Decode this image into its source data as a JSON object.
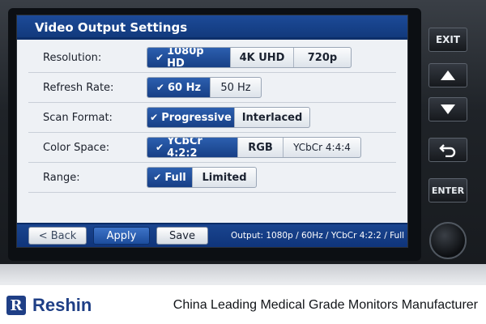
{
  "window": {
    "title": "Video Output Settings"
  },
  "settings": [
    {
      "label": "Resolution:",
      "options": [
        "1080p HD",
        "4K UHD",
        "720p"
      ],
      "selected": 0
    },
    {
      "label": "Refresh Rate:",
      "options": [
        "60 Hz",
        "50 Hz"
      ],
      "selected": 0
    },
    {
      "label": "Scan Format:",
      "options": [
        "Progressive",
        "Interlaced"
      ],
      "selected": 0
    },
    {
      "label": "Color Space:",
      "options": [
        "YCbCr 4:2:2",
        "RGB",
        "YCbCr 4:4:4"
      ],
      "selected": 0
    },
    {
      "label": "Range:",
      "options": [
        "Full",
        "Limited"
      ],
      "selected": 0
    }
  ],
  "bottom_bar": {
    "back_label": "< Back",
    "apply_label": "Apply",
    "save_label": "Save",
    "status": "Output: 1080p / 60Hz / YCbCr 4:2:2 / Full"
  },
  "hardware": {
    "exit_label": "EXIT",
    "up_icon": "up-arrow-icon",
    "down_icon": "down-arrow-icon",
    "return_icon": "return-arrow-icon",
    "enter_label": "ENTER"
  },
  "footer": {
    "brand": "Reshin",
    "tagline": "China Leading Medical Grade Monitors Manufacturer"
  },
  "colors": {
    "accent": "#173f86",
    "titlebar": "#123a7d",
    "brand": "#1f3f86"
  }
}
